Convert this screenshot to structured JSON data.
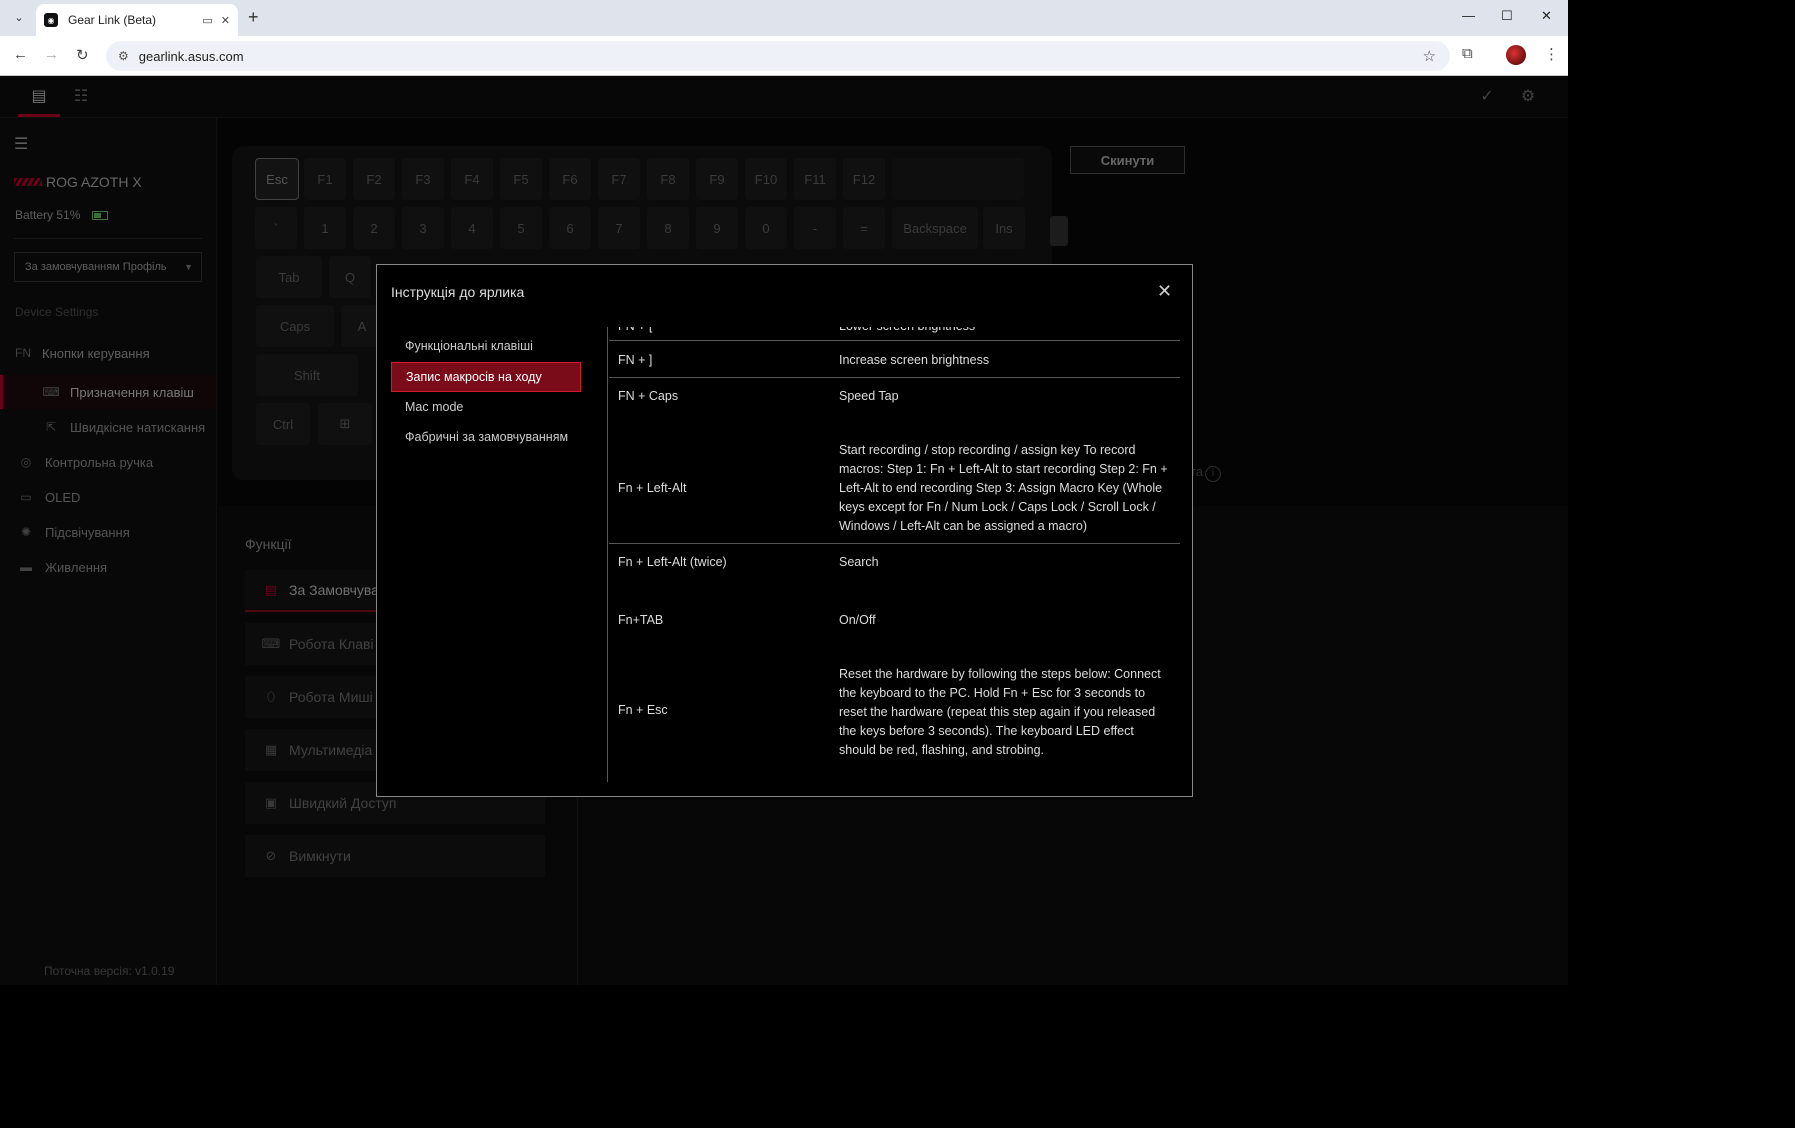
{
  "browser": {
    "tab_title": "Gear Link (Beta)",
    "url": "gearlink.asus.com"
  },
  "sidebar": {
    "device_name": "ROG AZOTH X",
    "battery": "Battery 51%",
    "profile": "За замовчуванням Профіль",
    "section_label": "Device Settings",
    "items": [
      {
        "label": "Кнопки керування",
        "icon": "fn-icon"
      },
      {
        "label": "Призначення клавіш",
        "icon": "keyboard-icon"
      },
      {
        "label": "Швидкісне натискання",
        "icon": "speed-tap-icon"
      },
      {
        "label": "Контрольна ручка",
        "icon": "knob-icon"
      },
      {
        "label": "OLED",
        "icon": "oled-icon"
      },
      {
        "label": "Підсвічування",
        "icon": "lighting-icon"
      },
      {
        "label": "Живлення",
        "icon": "battery-icon"
      }
    ],
    "version": "Поточна версія: v1.0.19"
  },
  "keyboard": {
    "row1": [
      "Esc",
      "F1",
      "F2",
      "F3",
      "F4",
      "F5",
      "F6",
      "F7",
      "F8",
      "F9",
      "F10",
      "F11",
      "F12"
    ],
    "row2": [
      "`",
      "1",
      "2",
      "3",
      "4",
      "5",
      "6",
      "7",
      "8",
      "9",
      "0",
      "-",
      "=",
      "Backspace",
      "Ins"
    ],
    "row3": [
      "Tab",
      "Q"
    ],
    "row4": [
      "Caps",
      "A"
    ],
    "row5": [
      "Shift"
    ],
    "row6": [
      "Ctrl",
      "⊞"
    ]
  },
  "main": {
    "reset_label": "Скинути",
    "info_fragment": "та",
    "functions_title": "Функції",
    "functions": [
      {
        "label": "За Замовчува",
        "icon": "default-icon"
      },
      {
        "label": "Робота Клаві",
        "icon": "keyboard-icon"
      },
      {
        "label": "Робота Миші",
        "icon": "mouse-icon"
      },
      {
        "label": "Мультимедіа",
        "icon": "multimedia-icon"
      },
      {
        "label": "Швидкий Доступ",
        "icon": "shortcut-icon"
      },
      {
        "label": "Вимкнути",
        "icon": "disable-icon"
      }
    ]
  },
  "modal": {
    "title": "Інструкція до ярлика",
    "nav": [
      "Функціональні клавіші",
      "Запис макросів на ходу",
      "Mac mode",
      "Фабричні за замовчуванням"
    ],
    "rows": [
      {
        "key": "FN + [",
        "value": "Lower screen brightness"
      },
      {
        "key": "FN + ]",
        "value": "Increase screen brightness"
      },
      {
        "key": "FN + Caps",
        "value": "Speed Tap"
      },
      {
        "key": "Fn + Left-Alt",
        "value": "Start recording / stop recording / assign key To record macros: Step 1: Fn + Left-Alt to start recording Step 2: Fn + Left-Alt to end recording Step 3: Assign Macro Key (Whole keys except for Fn / Num Lock / Caps Lock / Scroll Lock / Windows / Left-Alt can be assigned a macro)"
      },
      {
        "key": "Fn + Left-Alt (twice)",
        "value": "Search"
      },
      {
        "key": "Fn+TAB",
        "value": "On/Off"
      },
      {
        "key": "Fn + Esc",
        "value": "Reset the hardware by following the steps below: Connect the keyboard to the PC. Hold Fn + Esc for 3 seconds to reset the hardware (repeat this step again if you released the keys before 3 seconds). The keyboard LED effect should be red, flashing, and strobing."
      }
    ]
  }
}
